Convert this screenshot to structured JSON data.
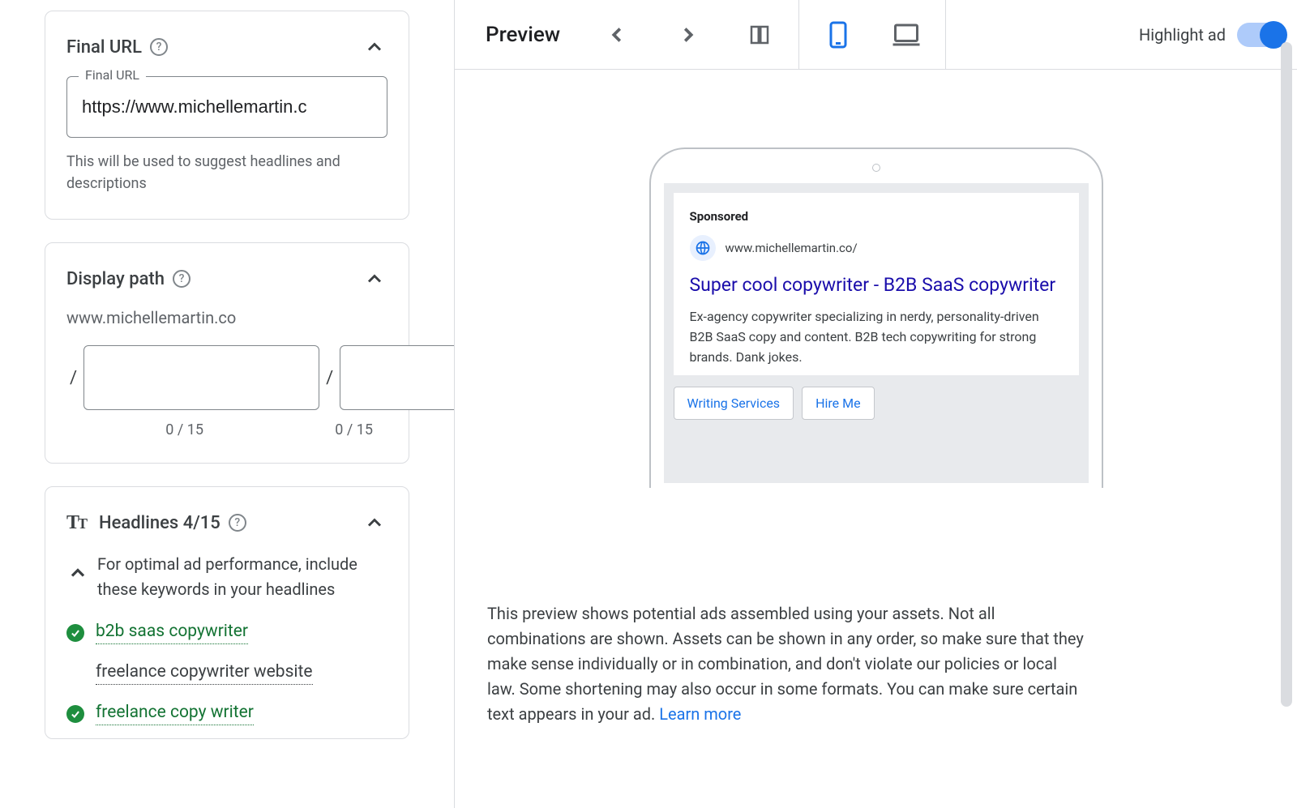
{
  "finalUrl": {
    "title": "Final URL",
    "inputLabel": "Final URL",
    "value": "https://www.michellemartin.c",
    "helper": "This will be used to suggest headlines and descriptions"
  },
  "displayPath": {
    "title": "Display path",
    "domain": "www.michellemartin.co",
    "slash": "/",
    "path1Count": "0 / 15",
    "path2Count": "0 / 15"
  },
  "headlines": {
    "title": "Headlines 4/15",
    "hint": "For optimal ad performance, include these keywords in your headlines",
    "keywords": [
      {
        "text": "b2b saas copywriter",
        "checked": true
      },
      {
        "text": "freelance copywriter website",
        "checked": false
      },
      {
        "text": "freelance copy writer",
        "checked": true
      }
    ]
  },
  "preview": {
    "title": "Preview",
    "highlightLabel": "Highlight ad",
    "ad": {
      "sponsored": "Sponsored",
      "displayUrl": "www.michellemartin.co/",
      "headline": "Super cool copywriter - B2B SaaS copywriter",
      "description": "Ex-agency copywriter specializing in nerdy, personality-driven B2B SaaS copy and content. B2B tech copywriting for strong brands. Dank jokes.",
      "sitelinks": [
        "Writing Services",
        "Hire Me"
      ]
    },
    "note": "This preview shows potential ads assembled using your assets. Not all combinations are shown. Assets can be shown in any order, so make sure that they make sense individually or in combination, and don't violate our policies or local law. Some shortening may also occur in some formats. You can make sure certain text appears in your ad. ",
    "learnMore": "Learn more"
  }
}
